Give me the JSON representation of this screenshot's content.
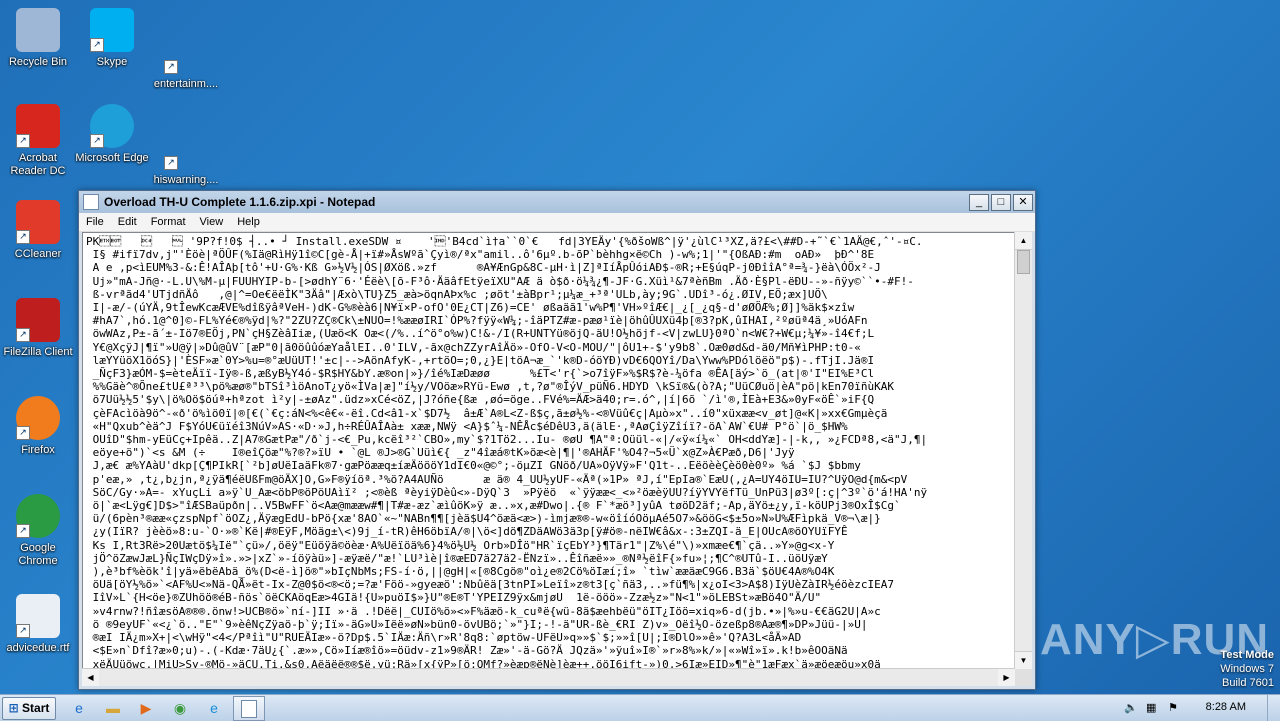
{
  "desktop": {
    "icons": [
      {
        "label": "Recycle Bin",
        "icon": "recycle-bin-icon"
      },
      {
        "label": "Skype",
        "icon": "skype-icon"
      },
      {
        "label": "entertainm....",
        "icon": "file-icon"
      },
      {
        "label": "Acrobat Reader DC",
        "icon": "acrobat-icon"
      },
      {
        "label": "Microsoft Edge",
        "icon": "edge-icon"
      },
      {
        "label": "hiswarning....",
        "icon": "file-icon"
      },
      {
        "label": "CCleaner",
        "icon": "ccleaner-icon"
      },
      {
        "label": "FileZilla Client",
        "icon": "filezilla-icon"
      },
      {
        "label": "Firefox",
        "icon": "firefox-icon"
      },
      {
        "label": "Google Chrome",
        "icon": "chrome-icon"
      },
      {
        "label": "advicedue.rtf",
        "icon": "word-icon"
      }
    ]
  },
  "window": {
    "title": "Overload TH-U Complete 1.1.6.zip.xpi - Notepad",
    "menu": [
      "File",
      "Edit",
      "Format",
      "View",
      "Help"
    ],
    "content_lines": [
      "PK\u0003\u0004   \u0014   \u0000 '9P?f!0$ ┤..• ┘ Install.exeSDW ¤    ''B4cd`ì†a``0`€   fd|3YEÄy'{%ðšoWß^|ÿ'¿ùlC¹³XZ,ä?£<\\##D-+˜`€`1AÄ@€,ˆ'-¤C.",
      " I§ #ifï7dv,j\"'Èöè|ªÖÛF(%Iä@RìHÿ1î©C[gè-Å|+ï#»ÅsWºã`Çyì®/ªx\"amil..ô'6µº.b-õP`bèhhg×ë©Ch )-w%;1|'\"{OßAÐ:#m  oAÐ»  þÐ^'8E",
      " A e ,p<ìEUM%3-&:Ê!AÎAþ[tô'+U·G%·Kß G»½V½|ÓS|ØXöß.»zf      ®A¥ÆnGp&8C-µH·ì|Z]ªIíÅpÛóiAÐ$-®R;+E§úqP-j0ÐîîA°ª=¾-}ëà\\ÓÖx²-J",
      " Uj»\"mA-Jñ@·-L.U\\%M-µ|FUUHYIP-b-[>ødhY¨6·'Éëè\\[õ-F³ô·ÄäâfEtÿeïXU\"AÆ ä ò$ð·ö¼¾¿¶-JF·G.Xüì¹&7ªèñBm .Äð·È§Pl-ëÐU--»-ñÿy©``•-#F!-",
      " ß-vrªãd4'UTjdñÄô   ,@|^=Oe€ëëÌK\"3Äâ\"|Æxò\\TU}Z5_æà>öqnAÞx%c ;øöt'±àBpr¹;µ¼æ_+³ª'ULb,ày;9G`.UDî³-ó¿.ØIV,EÖ;æx]UÖ\\",
      " I|-æ/-(úYÄ,9tÎewKcæÆVE%dîßÿâªVeH-)dK-G%®èà6|N¥ï×P-ofO'0E¿CT|Z6)=CE' øßaäã1'w%P¶'VH»ºîÆ€|_¿[_¿q§-d'øØÖÆ%;Ø]]%äk$×zîw",
      " #hA7`,hó.1@^0]©-FL%Yé€®%ÿd|%?\"2ZU?ZÇ®Ck\\±NUO=!%ææøIRI`ÓP%?fÿÿ«W¼;-îäPTZ#æ-pæø¹ïè|öhûÛUXü4þ[®3?pK,ûIHAI,²ºøüª4ä¸»UóAFn",
      " öwWAz,P±-ã´±-Iö7®EÖj,PN`çH§ZèâIiæ,(Uæö<K Oæ<(/%..í^ö°o%w)C!&-/I(R+UNTYü®öjQ-äU!O½höjf-<V|zwLU}0ªO`n<W€?+W€µ;¼¥»-î4€f;L",
      " Y€@XçÿJ|¶ï\"»U@ÿ|»Dû@ûV¨[æP\"0|ã0öûûóæYaålEI..0'ILV,-ãx@chZZyrAîÄö»-OfO-V<O-MOU/\"|ôU1+-$'y9b8`.Oæ0ød&d-ä0/Mñ¥ìPHP:t0-«",
      " læYYüöX1öóS}|'ÈSF»æ`0Y>%u=®°æUüUT!'±c|-->AönAfyK-,+rtöO=;0,¿}E|töA¬æ_`'k®D-óöYÐ)vD€6QOYî/Da\\Yww%PDólöëö\"p$)-.fTjI.Jä®I",
      " _ÑçF3}æÓM-$=èteÄïï-Iÿ®-ß,æßyB½Y4ó-$R$HY&bY.æ®on|»}/îé%IæDæøø      %£T<'r{`>o7îÿF»%$R$?è-¼öfa ®ÊA[äý>`ö_(at|®'I\"EI%E³Cl",
      " %%Gäè^®Õne£tU£ª³³\\pö%æø®\"bTSî³ìöAnoT¿yö«ÌVa|æ]\"í½y/VOöæ»RYü-Ewø ,t,?ø\"®ÎýV_püÑ6.HDYD \\kSï®&(ò?A;\"UüCØuö|èA\"pö|kEn70ïñùKAK",
      " ö7Uü½½5'$y\\|ö%Oö$öúª+hªzot ì²y|-±øAz\".üdz»xCé<öZ,|J?óñe{ßæ ,øó=öge..FVé%=ÄÆ>ä40;r=.ó^,|í|6õ `/ì'®,ÌEà+E3&»0yF«öÊ`»iF{Q",
      " çèFAcìöà9ö^-«ð'ö%ìö0ï|®[€(`€ç:áN<%<ê€«-ëî.Cd<â1-x`$D7½  â±Æ`A®L<Z-ß$ç,ã±ø½%-<®Vüû€ç|Aµò»x\"..í0\"xüxææ<v_øt]@«K|»xx€Gmµèçä",
      " «H\"Qxub^èä^J F$YóU€üïéî3NúV»AS·«D·»J,h÷RÉÛAÎAà± xææ,NWÿ <A}$ˆ¼-NÊÅc$éDêU3,ä(älE·,ªAøÇîÿZîíï?-öA`AW`€U# P°ö`|ö_$HW%",
      " OUîD\"$hm-yEüCç+Ipêä..Z|A7®GætPæ\"/ð`j-<€_Pu,kcëî³²`CBO»,my`$?1Tö2...Iu- ®øU ¶A\"ª:Oüül-«|/«ÿ«í¼«` OH<ddYæ]-|-k,, »¿FCDª8,<ä\"J,¶|",
      " eöye+ö\")`<s &M (÷    I®eîÇöæ\"%?®?»ïU • `@L ®J>®G`Uüì€{ _z\"4îæá®tK»öæ<è|¶|'®AHÄF'%O4?¬5«Ü`x@Z»À€Pæð,D6|'Jyÿ",
      " J,æ€ æ%YAàU'dkp[Ç¶PIkR[`²b]øUëIaäFk®7·gæPöææq±íæÄöööY1dI€0«@©°;-öµZI GNöð/UA»OÿVÿ»F'Q1t-..EëöèèÇèö0è0º» %á `$J $bbmy",
      " p'eæ,» ,t¿,b¿jn,ª¿ÿä¶éëUßFm@öÄX]O,G»F®ÿíöª.³%ö?A4AUÑö      æ ä® 4_UU½yUF-«Äª(»1P» ªJ,í\"EpIa®`EæU(,¿A=UY4öIU=IU?^UÿO@d{m&<pV",
      " SöC/Gy·»A=- xYuçLi a»ÿ`U_Aæ<öbP®öPöUAìï² ;<®èß ªèyiÿDèû<»-DÿQ`3  »Pÿëö  «`ÿÿææ<_<»²öæèÿUU?íÿYVYëfTü_UnPü3|ø3º[:ç|^3º`ö'á!HA'nÿ",
      " ö|`æ<Lÿg€]D$>\"îÆSBaüpðn|..V5BwFF`ö<Aæ@mææw#¶|T#æ-æz`æìûöK»ÿ æ..»x,æ#Dwo|.{® F`*æö³]yûA tøöD2äf;-Ap,äYö±¿y,ï-köUPj3®OxÎ$Cg`",
      " ü/(6pèn³®ææ«çzspNpf`öOZ¿,ÄÿægEdU-bPö{xæ'8AO`«~\"NABn¶¶[jèä$U4^öæä<æ>)-ìmjæ®®-w«öîíóOöµAé5O7»&ööG<$±5o»N»U%ÆFìpkä_V®¬\\æ|}",
      " ¿y(IïR? jèèö»8:u-`O·»®`Kë|#®EÿF,Möäg±\\<)9j_í-tR)êH6öbïA/®|\\ö<]dö¶ZDäAWö3ä3p[ÿ#ö®-nëIW€â&x-:3±ZQI-ä_E|OUcA®öOYUïFYÊ",
      " Ks I,Rt3Rë>20Uætö$¼Ië\"`çü»/,öëÿ\"Eüöÿä©öèæ·A%Uëïöä%6}4%ö½U½ Orb»DÎö\"HR`ïçEbY³}¶Tär1\"|Z%\\é\"\\)»xmæe€¶`çä..»Y»@g<x-Y",
      " jÖ^öZæwJæL}ÑçIWçDÿ»î».»>|xZ`»-íöÿàü»]-æÿæë/\"æ!`LU³ìè|î®æED7ä27ä2-ËNzï»..Êîñæë»»_®Nª½ëîF{»fu»¦;¶C^®UTû-I..üöUÿæY",
      " ),è³bf%èök'î|yä»ëbëAbä_ö%(D<ë-ì]ö®\"»bIçNbMs;FS-í·ö,||@gH|«[®8Cgö®\"oì¿e®2Cö%öIæí;î» `tìw`ææäæC9G6.B3ä`$öU€4A®%O4K",
      " öUä[öY½%ö»`<AF%U<»Nä-QÅ»ët-Ix-Z@0$ö<®<ö;=?æ'Föö-»gyeæö':Nbûëä[3tnPI»Leïî»z®t3[ç`ñä3,..»fü¶%|x¿oI<3>A$8)IÿUèZàIR½éöèzcIEA7",
      " IîV»L`{H<öe}®ZUhöö®éB-ñös`öëCKAöqEæ>4GIä!{U»puöI$»}U\"®E®T'YPEIZ9ÿx&mjøU  1ë-ööö»-Zzæ½z»\"N<1\"»öLEBSt»æBö4O\"Ä/U\"",
      " »v4rnw?!ñîæsöA®®®.önw!>UCB®ö»`ní-]II »·ä .!Dëë|_CUIö%ö»<»F%äæö-k_cuªë{wü-8ä$æehbëü\"öIT¿Iöö=xiq»6-d(jb.•»|%»u-€€äG2U|A»c",
      " ö ®9eyUF`«<¿`ö..\"E\"`9»èêNçZÿaö-þ`ÿ;Iï»-äG»U»Iëë»øN»bün0-övUBö;`»\"}I;-!-ä\"UR-ßè_€RI Z)v»_Oëî½O-özeßp8®Aæ®¶»DP»Jüü-|»U|",
      " ®æI IÄ¿m»X+|<\\wHÿ\"<4</Pªîì\"U\"RUEÄIæ»-ö?Dp$.5`IÄæ:Äñ\\r»R'8q8:`øptöw-UFëU»q»»$`$;»»î[U|;I®DlO»»ê»'Q?A3L<åÄ»AD",
      " <$E»n`Dfî?æ»0;u)-.(-Kdæ·7äU¿{`.æ»»,Cö»Iíæ®îö»=öüdv-z1»9®ÄR! Zæ»'-ä-Gö?Ä JQzä»'»ÿuî»I®`»r»8%»k/»|«»Wî»ï».k!b»êOOäNä",
      " xëÄUüöwc.|MiU>Sy-®Mö-»äÇU,Ti.&s0.Aëäëë®®$ë.yü;Rä»[x{ÿP»[ö;QMf?»èæp®ëNè]èæ++,ööI6ift-»)0,>6Iæ»EID»¶\"è\"1æFæx`ä»æöeæöu»x0ä"
    ]
  },
  "taskbar": {
    "start_label": "Start",
    "clock": "8:28 AM"
  },
  "watermark": {
    "text": "ANY▷RUN"
  },
  "testmode": {
    "line1": "Test Mode",
    "line2": "Windows 7",
    "line3": "Build 7601"
  }
}
